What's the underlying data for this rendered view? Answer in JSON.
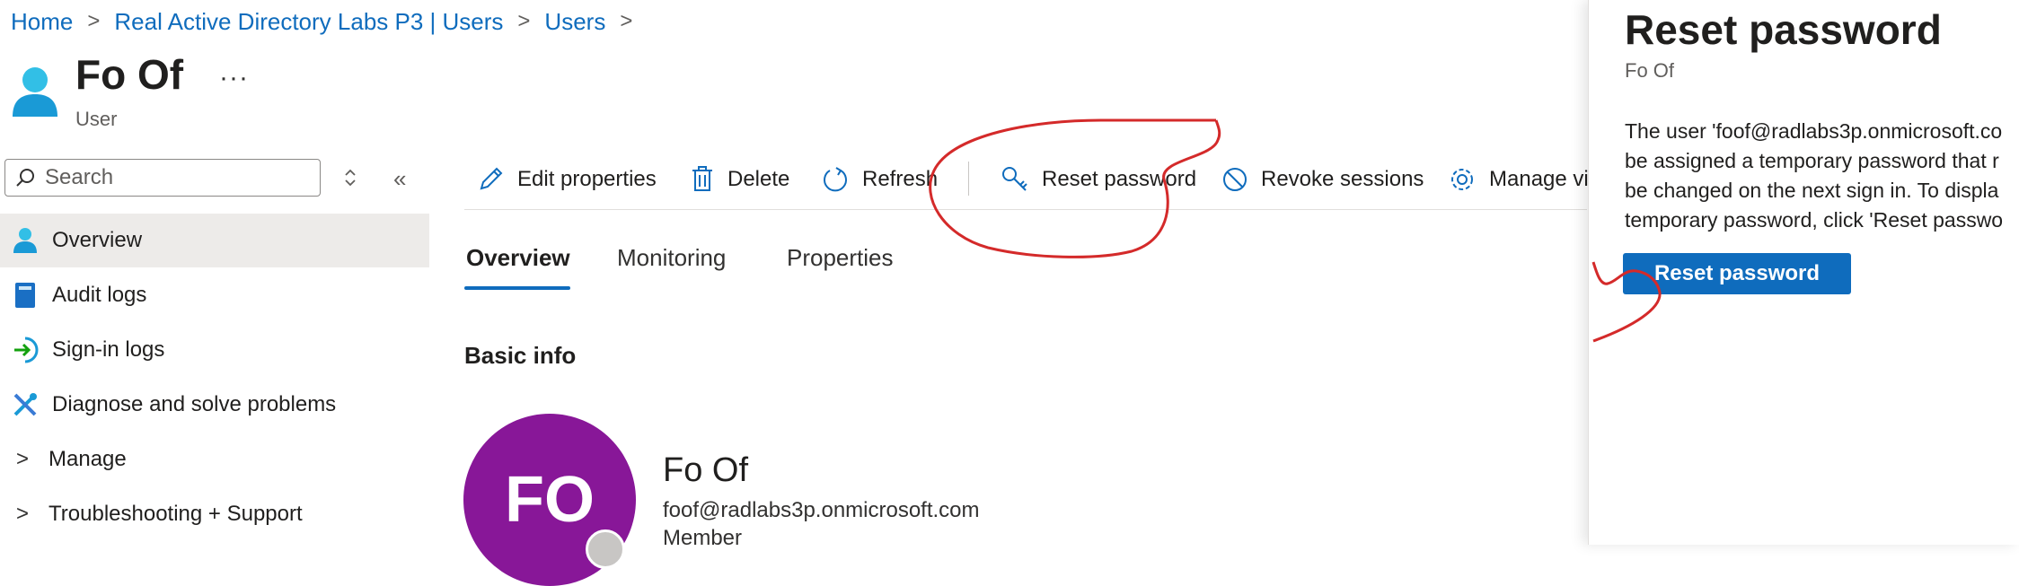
{
  "breadcrumb": {
    "items": [
      "Home",
      "Real Active Directory Labs P3 | Users",
      "Users"
    ]
  },
  "header": {
    "title": "Fo Of",
    "subtitle": "User",
    "more_label": "···"
  },
  "search": {
    "placeholder": "Search"
  },
  "sidebar": {
    "items": [
      {
        "label": "Overview",
        "icon": "user-icon",
        "active": true
      },
      {
        "label": "Audit logs",
        "icon": "book-icon"
      },
      {
        "label": "Sign-in logs",
        "icon": "sign-in-icon"
      },
      {
        "label": "Diagnose and solve problems",
        "icon": "wrench-icon"
      },
      {
        "label": "Manage",
        "icon": "chevron-right-icon"
      },
      {
        "label": "Troubleshooting + Support",
        "icon": "chevron-right-icon"
      }
    ]
  },
  "toolbar": {
    "edit_label": "Edit properties",
    "delete_label": "Delete",
    "refresh_label": "Refresh",
    "reset_password_label": "Reset password",
    "revoke_sessions_label": "Revoke sessions",
    "manage_view_label": "Manage vi"
  },
  "tabs": [
    {
      "label": "Overview",
      "active": true
    },
    {
      "label": "Monitoring"
    },
    {
      "label": "Properties"
    }
  ],
  "section": {
    "basic_info": "Basic info"
  },
  "profile": {
    "initials": "FO",
    "name": "Fo Of",
    "email": "foof@radlabs3p.onmicrosoft.com",
    "type": "Member",
    "avatar_color": "#881798"
  },
  "panel": {
    "title": "Reset password",
    "subtitle": "Fo Of",
    "description_lines": [
      "The user 'foof@radlabs3p.onmicrosoft.co",
      "be assigned a temporary password that r",
      "be changed on the next sign in. To displa",
      "temporary password, click 'Reset passwo"
    ],
    "button_label": "Reset password"
  },
  "colors": {
    "accent": "#0f6cbd",
    "annotation": "#d42a2a"
  }
}
